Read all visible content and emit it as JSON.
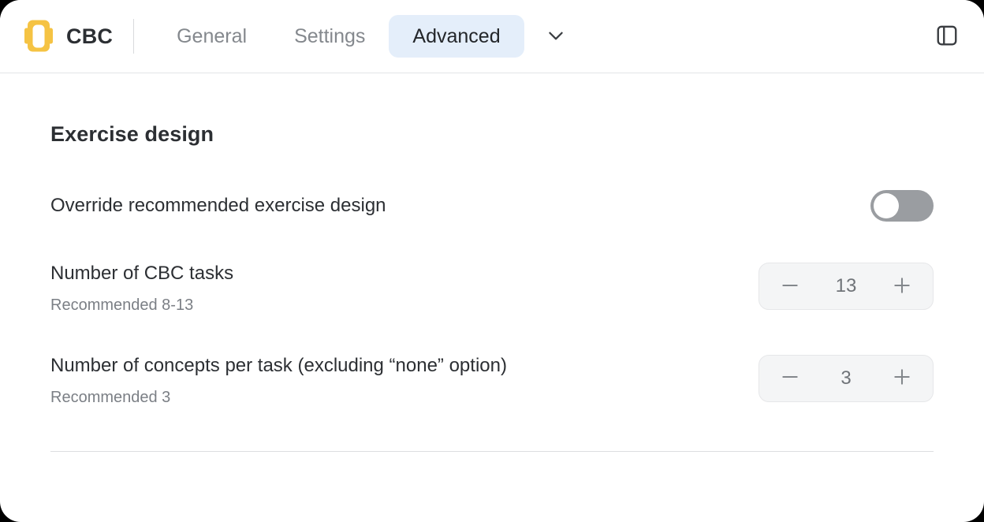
{
  "window": {
    "title": "CBC — Advanced",
    "background": "#ffffff",
    "accent_color": "#f5c343",
    "active_tab_bg": "#e4eefa"
  },
  "header": {
    "logo_icon": "cbc-logo-icon",
    "brand_name": "CBC",
    "tabs": [
      {
        "label": "General",
        "active": false
      },
      {
        "label": "Settings",
        "active": false
      },
      {
        "label": "Advanced",
        "active": true
      }
    ],
    "chevron_icon": "chevron-down-icon",
    "panel_toggle_icon": "sidebar-panel-icon"
  },
  "main": {
    "section_title": "Exercise design",
    "settings": [
      {
        "label": "Override recommended exercise design",
        "sub": "",
        "control": "toggle",
        "value": "off"
      },
      {
        "label": "Number of CBC tasks",
        "sub": "Recommended 8-13",
        "control": "stepper",
        "value": "13",
        "decrement_icon": "minus-icon",
        "increment_icon": "plus-icon"
      },
      {
        "label": "Number of concepts per task (excluding “none” option)",
        "sub": "Recommended 3",
        "control": "stepper",
        "value": "3",
        "decrement_icon": "minus-icon",
        "increment_icon": "plus-icon"
      }
    ]
  }
}
